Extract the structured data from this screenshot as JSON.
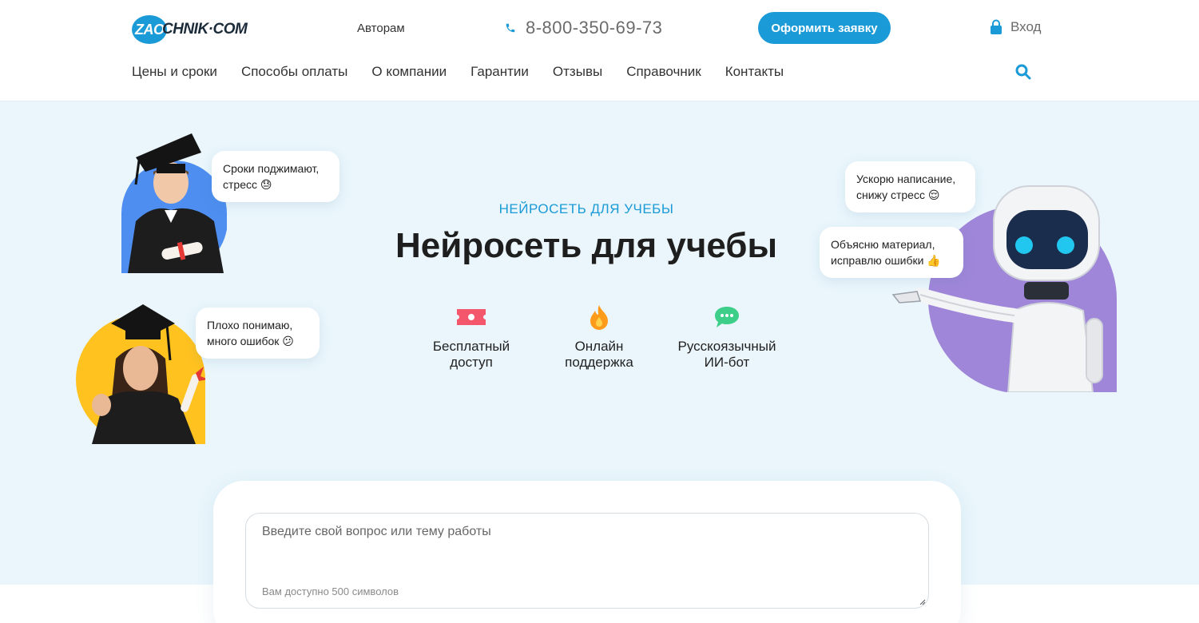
{
  "header": {
    "logo_prefix": "ZAO",
    "logo_rest": "CHNIK·COM",
    "authors_link": "Авторам",
    "phone": "8-800-350-69-73",
    "cta_label": "Оформить заявку",
    "login_label": "Вход",
    "nav": [
      "Цены и сроки",
      "Способы оплаты",
      "О компании",
      "Гарантии",
      "Отзывы",
      "Справочник",
      "Контакты"
    ]
  },
  "hero": {
    "subtitle": "НЕЙРОСЕТЬ ДЛЯ УЧЕБЫ",
    "title": "Нейросеть для учебы",
    "features": [
      {
        "label_line1": "Бесплатный",
        "label_line2": "доступ",
        "icon": "ticket-icon"
      },
      {
        "label_line1": "Онлайн",
        "label_line2": "поддержка",
        "icon": "flame-icon"
      },
      {
        "label_line1": "Русскоязычный",
        "label_line2": "ИИ-бот",
        "icon": "chat-icon"
      }
    ],
    "bubbles": {
      "student_male_line1": "Сроки поджимают,",
      "student_male_line2": "стресс 😓",
      "student_female_line1": "Плохо понимаю,",
      "student_female_line2": "много ошибок 😕",
      "robot_1_line1": "Ускорю написание,",
      "robot_1_line2": "снижу стресс 😌",
      "robot_2_line1": "Объясню материал,",
      "robot_2_line2": "исправлю ошибки 👍"
    }
  },
  "question_form": {
    "placeholder": "Введите свой вопрос или тему работы",
    "counter": "Вам доступно 500 символов"
  },
  "colors": {
    "accent": "#1a9ad6",
    "hero_bg": "#eaf6fc",
    "male_circle": "#4d8ef0",
    "female_circle": "#ffc21f",
    "robot_circle": "#9f86d9"
  }
}
